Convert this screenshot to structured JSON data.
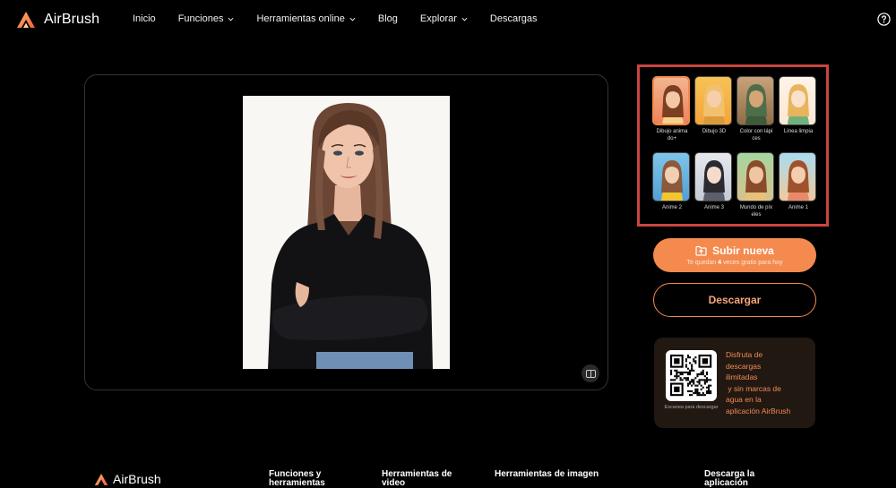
{
  "brand": {
    "name": "AirBrush",
    "accent": "#f58a4e"
  },
  "nav": {
    "items": [
      {
        "label": "Inicio",
        "dropdown": false
      },
      {
        "label": "Funciones",
        "dropdown": true
      },
      {
        "label": "Herramientas online",
        "dropdown": true
      },
      {
        "label": "Blog",
        "dropdown": false
      },
      {
        "label": "Explorar",
        "dropdown": true
      },
      {
        "label": "Descargas",
        "dropdown": false
      }
    ],
    "help_icon": "question-circle-icon"
  },
  "styles": [
    {
      "label": "Dibujo animado+",
      "line1": "Dibujo anima",
      "line2": "do+",
      "selected": true
    },
    {
      "label": "Dibujo 3D",
      "line1": "Dibujo 3D",
      "line2": ""
    },
    {
      "label": "Color con lápices",
      "line1": "Color con lápi",
      "line2": "ces"
    },
    {
      "label": "Línea limpia",
      "line1": "Línea limpia",
      "line2": ""
    },
    {
      "label": "Anime 2",
      "line1": "Anime 2",
      "line2": ""
    },
    {
      "label": "Anime 3",
      "line1": "Anime 3",
      "line2": ""
    },
    {
      "label": "Mundo de píxeles",
      "line1": "Mundo de píx",
      "line2": "eles"
    },
    {
      "label": "Anime 1",
      "line1": "Anime 1",
      "line2": ""
    }
  ],
  "actions": {
    "upload_label": "Subir nueva",
    "upload_sub_prefix": "Te quedan ",
    "upload_sub_count": "4",
    "upload_sub_suffix": " veces gratis para hoy",
    "download_label": "Descargar"
  },
  "promo": {
    "qr_caption": "Escanea para descargar",
    "lines": [
      "Disfruta de",
      "descargas",
      "ilimitadas",
      " y sin marcas de",
      "agua en la",
      "aplicación AirBrush"
    ]
  },
  "footer": {
    "brand": "AirBrush",
    "columns": [
      "Funciones y herramientas",
      "Herramientas de video",
      "Herramientas de imagen",
      "Descarga la aplicación"
    ]
  }
}
